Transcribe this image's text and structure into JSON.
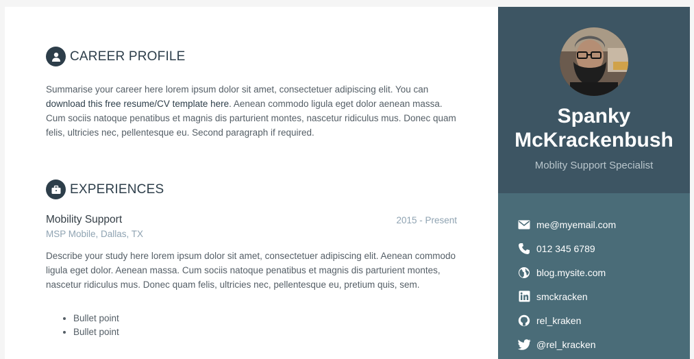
{
  "career_profile": {
    "title": "CAREER PROFILE",
    "icon": "user-icon",
    "text_before_link": "Summarise your career here lorem ipsum dolor sit amet, consectetuer adipiscing elit. You can ",
    "link_text": "download this free resume/CV template here",
    "text_after_link": ". Aenean commodo ligula eget dolor aenean massa. Cum sociis natoque penatibus et magnis dis parturient montes, nascetur ridiculus mus. Donec quam felis, ultricies nec, pellentesque eu. Second paragraph if required."
  },
  "experiences": {
    "title": "EXPERIENCES",
    "icon": "briefcase-icon",
    "items": [
      {
        "role": "Mobility Support",
        "company": "MSP Mobile, Dallas, TX",
        "date": "2015 - Present",
        "description": "Describe your study here lorem ipsum dolor sit amet, consectetuer adipiscing elit. Aenean commodo ligula eget dolor. Aenean massa. Cum sociis natoque penatibus et magnis dis parturient montes, nascetur ridiculus mus. Donec quam felis, ultricies nec, pellentesque eu, pretium quis, sem.",
        "bullets": [
          "Bullet point",
          "Bullet point"
        ]
      }
    ]
  },
  "profile": {
    "name_line1": "Spanky",
    "name_line2": "McKrackenbush",
    "tagline": "Moblity Support Specialist"
  },
  "contacts": [
    {
      "icon": "envelope-icon",
      "text": "me@myemail.com"
    },
    {
      "icon": "phone-icon",
      "text": "012 345 6789"
    },
    {
      "icon": "globe-icon",
      "text": "blog.mysite.com"
    },
    {
      "icon": "linkedin-icon",
      "text": "smckracken"
    },
    {
      "icon": "github-icon",
      "text": "rel_kraken"
    },
    {
      "icon": "twitter-icon",
      "text": "@rel_kracken"
    }
  ],
  "colors": {
    "sidebar_dark": "#3d5563",
    "sidebar_light": "#4a6c78",
    "heading": "#2d3e4a",
    "muted": "#8fa3b2"
  }
}
